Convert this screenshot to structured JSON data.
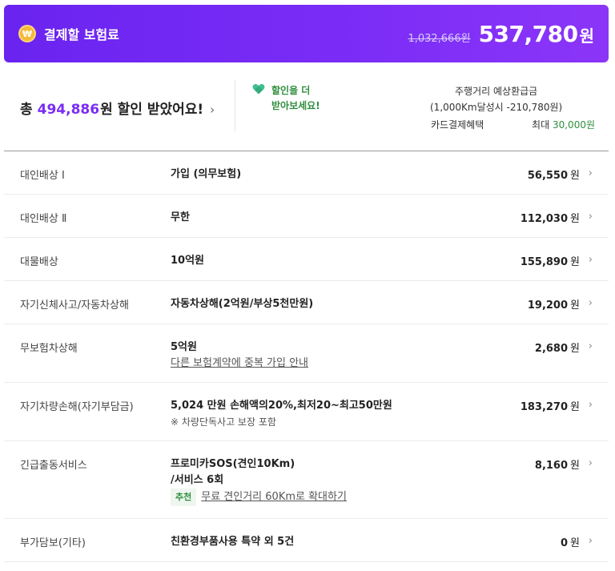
{
  "header": {
    "coin_icon_glyph": "₩",
    "title": "결제할 보험료",
    "original_price": "1,032,666원",
    "final_price": "537,780",
    "final_unit": "원"
  },
  "summary": {
    "discount_prefix": "총",
    "discount_amount": "494,886",
    "discount_suffix": "원 할인 받았어요!",
    "promo_line1": "할인을 더",
    "promo_line2": "받아보세요!",
    "mileage_line1": "주행거리 예상환급금",
    "mileage_line2": "(1,000Km달성시 -210,780원)",
    "card_label": "카드결제혜택",
    "card_max_prefix": "최대",
    "card_max_value": "30,000원",
    "chevron": "›"
  },
  "rows": [
    {
      "label": "대인배상 Ⅰ",
      "detail": "가입 (의무보험)",
      "amount": "56,550",
      "unit": "원"
    },
    {
      "label": "대인배상 Ⅱ",
      "detail": "무한",
      "amount": "112,030",
      "unit": "원"
    },
    {
      "label": "대물배상",
      "detail": "10억원",
      "amount": "155,890",
      "unit": "원"
    },
    {
      "label": "자기신체사고/자동차상해",
      "detail": "자동차상해(2억원/부상5천만원)",
      "amount": "19,200",
      "unit": "원"
    },
    {
      "label": "무보험차상해",
      "detail": "5억원",
      "link": "다른 보험계약에 중복 가입 안내",
      "amount": "2,680",
      "unit": "원"
    },
    {
      "label": "자기차량손해(자기부담금)",
      "detail": "5,024 만원 손해액의20%,최저20~최고50만원",
      "sub": "※ 차량단독사고 보장 포함",
      "amount": "183,270",
      "unit": "원"
    },
    {
      "label": "긴급출동서비스",
      "detail": "프로미카SOS(견인10Km)",
      "detail2": "/서비스 6회",
      "rec_badge": "추천",
      "rec_link": "무료 견인거리 60Km로 확대하기",
      "amount": "8,160",
      "unit": "원"
    },
    {
      "label": "부가담보(기타)",
      "detail": "친환경부품사용 특약 외 5건",
      "amount": "0",
      "unit": "원"
    }
  ]
}
